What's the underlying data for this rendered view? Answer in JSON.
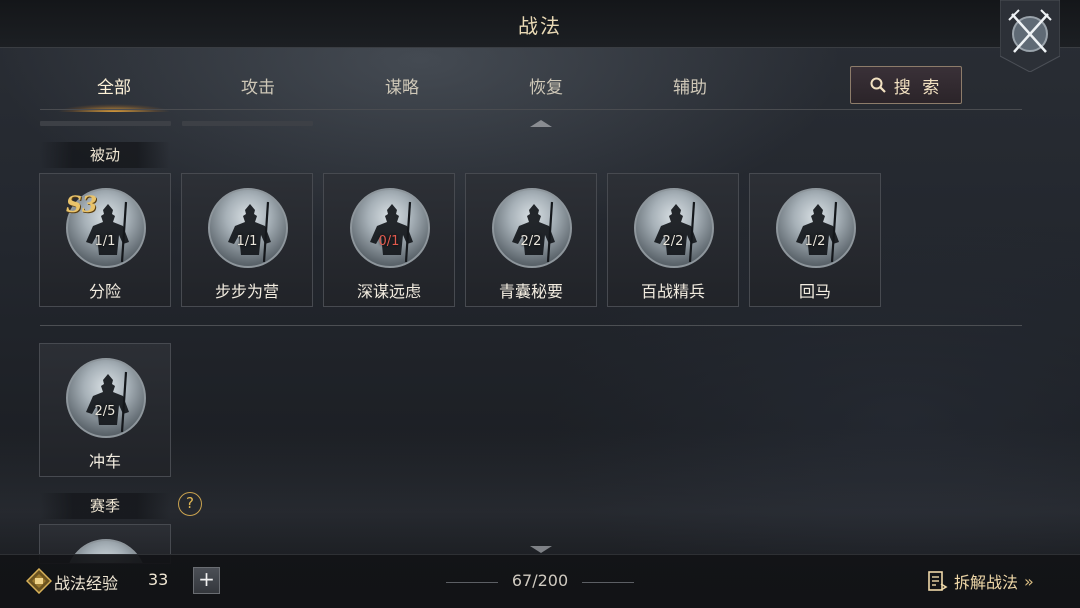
{
  "header": {
    "title": "战法"
  },
  "tabs": [
    {
      "label": "全部",
      "active": true
    },
    {
      "label": "攻击",
      "active": false
    },
    {
      "label": "谋略",
      "active": false
    },
    {
      "label": "恢复",
      "active": false
    },
    {
      "label": "辅助",
      "active": false
    }
  ],
  "search": {
    "label": "搜 索",
    "icon": "search-icon"
  },
  "sections": {
    "passive": {
      "label": "被动"
    },
    "season": {
      "label": "赛季",
      "help": "?"
    }
  },
  "passive_cards": [
    {
      "name": "分险",
      "count": "1/1",
      "badge": "S3",
      "count_color": "#e9e5db"
    },
    {
      "name": "步步为营",
      "count": "1/1",
      "count_color": "#e9e5db"
    },
    {
      "name": "深谋远虑",
      "count": "0/1",
      "count_color": "#e05a4e"
    },
    {
      "name": "青囊秘要",
      "count": "2/2",
      "count_color": "#e9e5db"
    },
    {
      "name": "百战精兵",
      "count": "2/2",
      "count_color": "#e9e5db"
    },
    {
      "name": "回马",
      "count": "1/2",
      "count_color": "#e9e5db"
    }
  ],
  "other_cards": [
    {
      "name": "冲车",
      "count": "2/5"
    }
  ],
  "bottom": {
    "exp_label": "战法经验",
    "exp_value": "33",
    "plus": "+",
    "capacity": "67/200",
    "dismantle": "拆解战法",
    "dismantle_chevron": "»"
  },
  "colors": {
    "accent_gold": "#e9c36a",
    "tab_glow": "#f0aa3c",
    "warning_red": "#e05a4e"
  }
}
